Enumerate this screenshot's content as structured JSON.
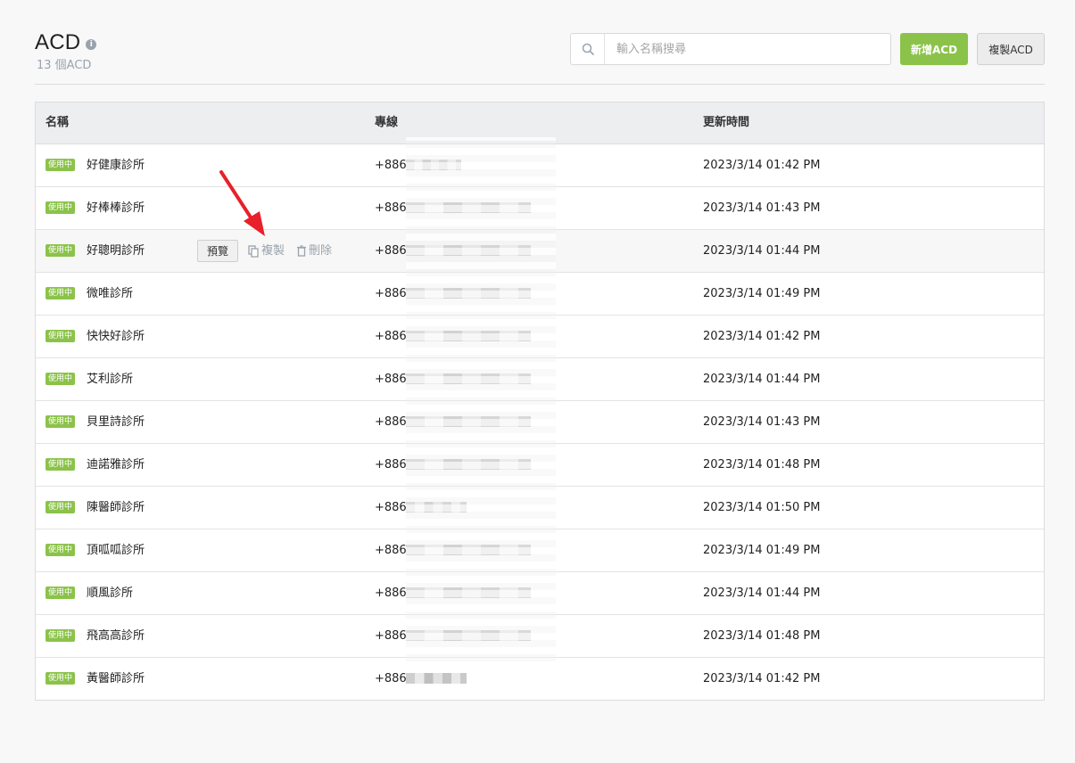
{
  "header": {
    "title": "ACD",
    "count": "13 個ACD",
    "search_placeholder": "輸入名稱搜尋",
    "add_button": "新增ACD",
    "copy_button": "複製ACD"
  },
  "table": {
    "columns": [
      "名稱",
      "專線",
      "更新時間"
    ],
    "row_actions": {
      "preview": "預覽",
      "copy": "複製",
      "delete": "刪除"
    },
    "rows": [
      {
        "status": "使用中",
        "name": "好健康診所",
        "line_prefix": "+886",
        "updated": "2023/3/14 01:42 PM"
      },
      {
        "status": "使用中",
        "name": "好棒棒診所",
        "line_prefix": "+886",
        "updated": "2023/3/14 01:43 PM"
      },
      {
        "status": "使用中",
        "name": "好聰明診所",
        "line_prefix": "+886",
        "updated": "2023/3/14 01:44 PM"
      },
      {
        "status": "使用中",
        "name": "微唯診所",
        "line_prefix": "+886",
        "updated": "2023/3/14 01:49 PM"
      },
      {
        "status": "使用中",
        "name": "快快好診所",
        "line_prefix": "+886",
        "updated": "2023/3/14 01:42 PM"
      },
      {
        "status": "使用中",
        "name": "艾利診所",
        "line_prefix": "+886",
        "updated": "2023/3/14 01:44 PM"
      },
      {
        "status": "使用中",
        "name": "貝里詩診所",
        "line_prefix": "+886",
        "updated": "2023/3/14 01:43 PM"
      },
      {
        "status": "使用中",
        "name": "迪諾雅診所",
        "line_prefix": "+886",
        "updated": "2023/3/14 01:48 PM"
      },
      {
        "status": "使用中",
        "name": "陳醫師診所",
        "line_prefix": "+886",
        "updated": "2023/3/14 01:50 PM"
      },
      {
        "status": "使用中",
        "name": "頂呱呱診所",
        "line_prefix": "+886",
        "updated": "2023/3/14 01:49 PM"
      },
      {
        "status": "使用中",
        "name": "順風診所",
        "line_prefix": "+886",
        "updated": "2023/3/14 01:44 PM"
      },
      {
        "status": "使用中",
        "name": "飛高高診所",
        "line_prefix": "+886",
        "updated": "2023/3/14 01:48 PM"
      },
      {
        "status": "使用中",
        "name": "黃醫師診所",
        "line_prefix": "+886",
        "updated": "2023/3/14 01:42 PM"
      }
    ]
  },
  "colors": {
    "accent": "#8bc34a",
    "muted": "#9aa3ad",
    "annotation_arrow": "#e8202a"
  },
  "icons": [
    "info-icon",
    "search-icon",
    "copy-icon",
    "trash-icon"
  ]
}
